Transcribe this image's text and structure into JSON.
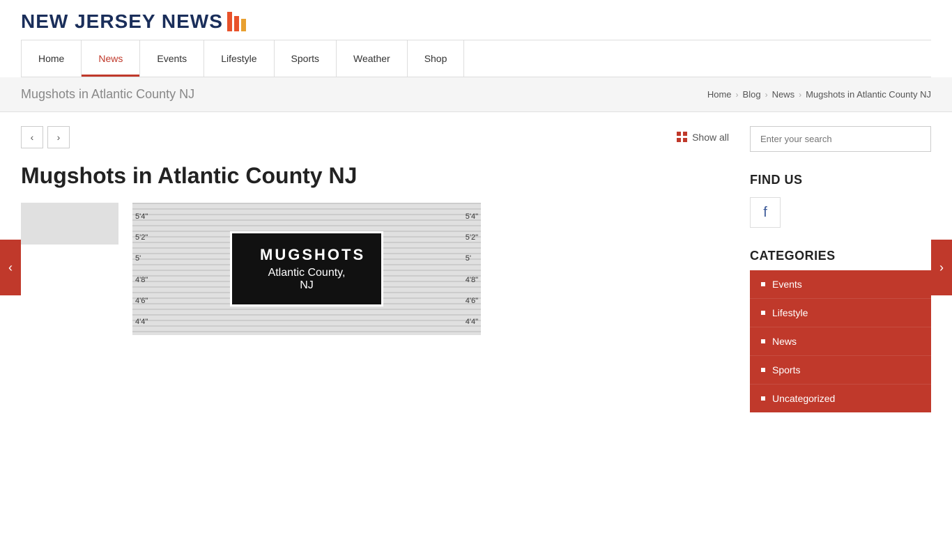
{
  "site": {
    "name": "NEW JERSEY NEWS",
    "logo_bars": [
      "bar1",
      "bar2",
      "bar3"
    ]
  },
  "nav": {
    "items": [
      {
        "label": "Home",
        "active": false
      },
      {
        "label": "News",
        "active": true
      },
      {
        "label": "Events",
        "active": false
      },
      {
        "label": "Lifestyle",
        "active": false
      },
      {
        "label": "Sports",
        "active": false
      },
      {
        "label": "Weather",
        "active": false
      },
      {
        "label": "Shop",
        "active": false
      }
    ]
  },
  "breadcrumb": {
    "page_title": "Mugshots in Atlantic County NJ",
    "items": [
      "Home",
      "Blog",
      "News",
      "Mugshots in Atlantic County NJ"
    ]
  },
  "content": {
    "article_title": "Mugshots in Atlantic County NJ",
    "show_all_label": "Show all",
    "mugshot_lines": [
      "5'4\"",
      "5'2\"",
      "5'",
      "4'8\"",
      "4'6\"",
      "4'4\""
    ],
    "mugshot_title": "MUGSHOTS",
    "mugshot_subtitle": "Atlantic County, NJ"
  },
  "sidebar": {
    "search_placeholder": "Enter your search",
    "find_us_title": "FIND US",
    "categories_title": "CATEGORIES",
    "categories": [
      {
        "label": "Events"
      },
      {
        "label": "Lifestyle"
      },
      {
        "label": "News"
      },
      {
        "label": "Sports"
      },
      {
        "label": "Uncategorized"
      }
    ]
  },
  "side_nav": {
    "left_arrow": "‹",
    "right_arrow": "›"
  }
}
